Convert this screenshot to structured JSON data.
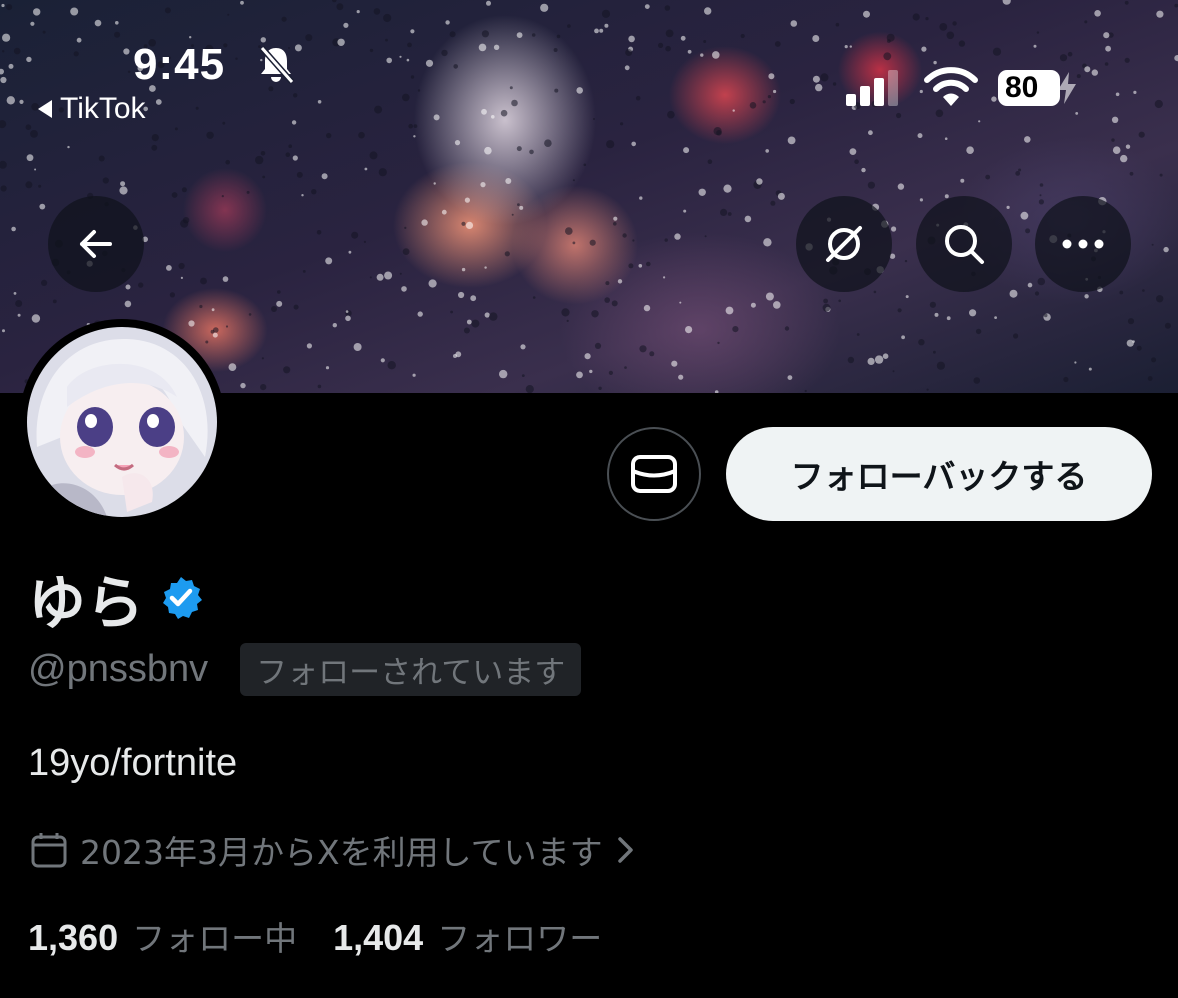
{
  "status_bar": {
    "time": "9:45",
    "back_app": "TikTok",
    "battery": "80"
  },
  "nav": {
    "back_icon": "arrow-left-icon",
    "grok_icon": "grok-icon",
    "search_icon": "search-icon",
    "more_icon": "more-icon"
  },
  "profile": {
    "name": "ゆら",
    "handle": "@pnssbnv",
    "follows_you": "フォローされています",
    "bio": "19yo/fortnite",
    "joined": "2023年3月からXを利用しています",
    "following_count": "1,360",
    "following_label": "フォロー中",
    "followers_count": "1,404",
    "followers_label": "フォロワー"
  },
  "actions": {
    "follow_back": "フォローバックする",
    "message_icon": "mail-icon"
  },
  "colors": {
    "verified": "#1d9bf0",
    "background": "#000000",
    "secondary_text": "#71767b",
    "button_bg": "#eff3f4"
  }
}
